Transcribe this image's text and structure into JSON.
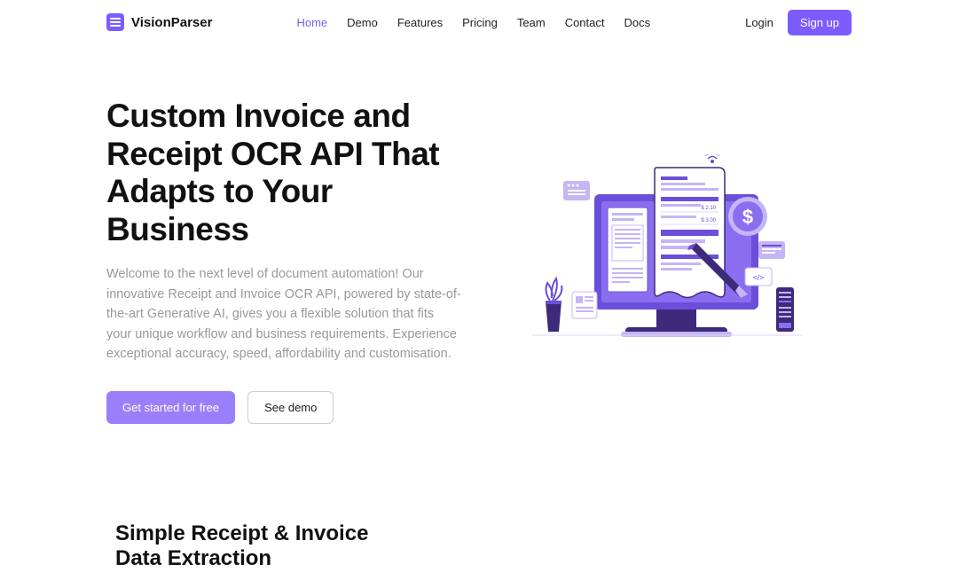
{
  "brand": {
    "name": "VisionParser"
  },
  "nav": {
    "items": [
      "Home",
      "Demo",
      "Features",
      "Pricing",
      "Team",
      "Contact",
      "Docs"
    ],
    "activeIndex": 0
  },
  "auth": {
    "login": "Login",
    "signup": "Sign up"
  },
  "hero": {
    "title": "Custom Invoice and Receipt OCR API That Adapts to Your Business",
    "description": "Welcome to the next level of document automation! Our innovative Receipt and Invoice OCR API, powered by state-of-the-art Generative AI, gives you a flexible solution that fits your unique workflow and business requirements. Experience exceptional accuracy, speed, affordability and customisation.",
    "cta_primary": "Get started for free",
    "cta_secondary": "See demo",
    "illustration_labels": {
      "price1": "$ 2.10",
      "price2": "$ 3.00",
      "dollar": "$",
      "code": "</>"
    }
  },
  "section2": {
    "title": "Simple Receipt & Invoice Data Extraction"
  }
}
